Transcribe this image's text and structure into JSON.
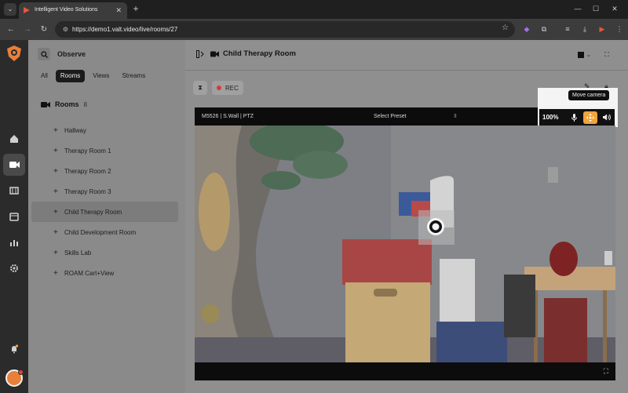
{
  "browser": {
    "tab_title": "Intelligent Video Solutions",
    "url": "https://demo1.valt.video/live/rooms/27"
  },
  "sidebar": {
    "title": "Observe",
    "filters": [
      "All",
      "Rooms",
      "Views",
      "Streams"
    ],
    "active_filter": "Rooms",
    "rooms_title": "Rooms",
    "rooms_count": "8",
    "rooms": [
      "Hallway",
      "Therapy Room 1",
      "Therapy Room 2",
      "Therapy Room 3",
      "Child Therapy Room",
      "Child Development Room",
      "Skills Lab",
      "ROAM Cart+View"
    ],
    "selected_room": "Child Therapy Room"
  },
  "main": {
    "room_name": "Child Therapy Room",
    "rec_label": "REC"
  },
  "player": {
    "camera_label": "M5526 | S.Wall | PTZ",
    "preset_label": "Select Preset",
    "zoom": "100%",
    "tooltip": "Move camera"
  },
  "colors": {
    "accent": "#f0a43c",
    "rec": "#d93a3a"
  }
}
